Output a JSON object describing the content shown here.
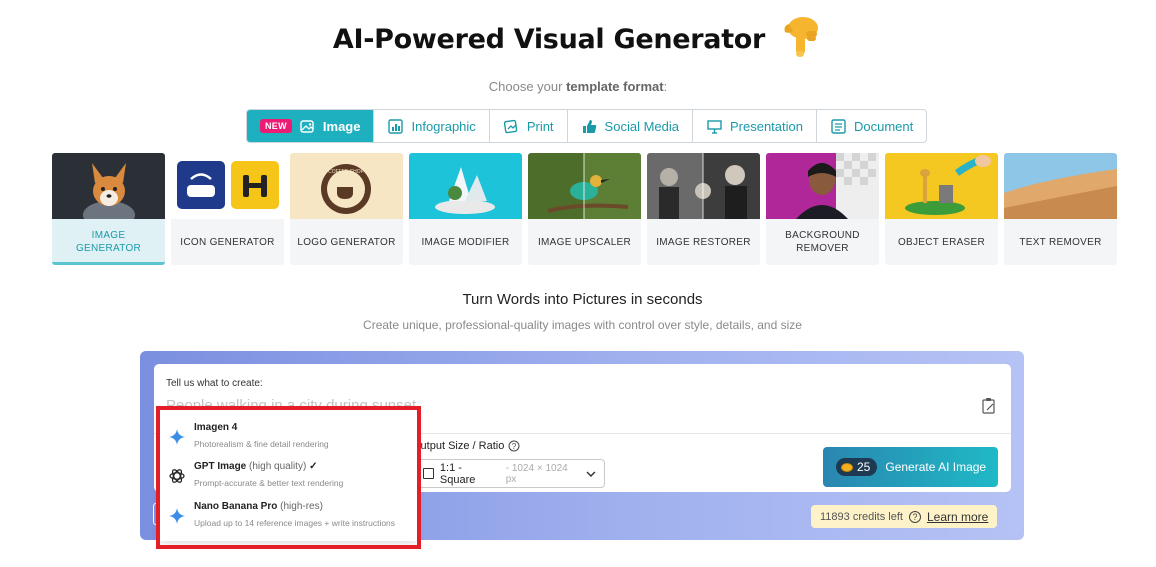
{
  "header": {
    "title": "AI-Powered Visual Generator"
  },
  "format_prompt": {
    "prefix": "Choose your ",
    "bold": "template format",
    "suffix": ":"
  },
  "tabs": [
    {
      "label": "Image",
      "badge": "NEW",
      "icon": "image-icon",
      "active": true
    },
    {
      "label": "Infographic",
      "icon": "chart-icon"
    },
    {
      "label": "Print",
      "icon": "print-icon"
    },
    {
      "label": "Social Media",
      "icon": "thumbs-up-icon"
    },
    {
      "label": "Presentation",
      "icon": "presentation-icon"
    },
    {
      "label": "Document",
      "icon": "document-icon"
    }
  ],
  "tools": [
    {
      "label": "IMAGE GENERATOR",
      "active": true
    },
    {
      "label": "ICON GENERATOR"
    },
    {
      "label": "LOGO GENERATOR",
      "logo_text": "COFFEE SHOP"
    },
    {
      "label": "IMAGE MODIFIER"
    },
    {
      "label": "IMAGE UPSCALER"
    },
    {
      "label": "IMAGE RESTORER"
    },
    {
      "label": "BACKGROUND REMOVER"
    },
    {
      "label": "OBJECT ERASER"
    },
    {
      "label": "TEXT REMOVER"
    }
  ],
  "section": {
    "title": "Turn Words into Pictures in seconds",
    "subtitle": "Create unique, professional-quality images with control over style, details, and size"
  },
  "input": {
    "label": "Tell us what to create:",
    "placeholder": "People walking in a city during sunset"
  },
  "output_size": {
    "label": "Output Size / Ratio",
    "value": "1:1 - Square",
    "dimensions": "1024 × 1024 px"
  },
  "generate": {
    "cost": "25",
    "label": "Generate AI Image"
  },
  "credits": {
    "text": "11893 credits left",
    "link": "Learn more"
  },
  "model_menu": {
    "options": [
      {
        "name": "Imagen 4",
        "qualifier": "",
        "desc": "Photorealism & fine detail rendering",
        "icon": "sparkle-icon",
        "selected": false
      },
      {
        "name": "GPT Image",
        "qualifier": "(high quality)",
        "desc": "Prompt-accurate & better text rendering",
        "icon": "openai-icon",
        "selected": true
      },
      {
        "name": "Nano Banana Pro",
        "qualifier": "(high-res)",
        "desc": "Upload up to 14 reference images + write instructions",
        "icon": "sparkle-icon",
        "selected": false
      }
    ]
  },
  "colors": {
    "accent": "#1fb0bf",
    "badge": "#ec1b73",
    "highlight": "#e41e26"
  }
}
